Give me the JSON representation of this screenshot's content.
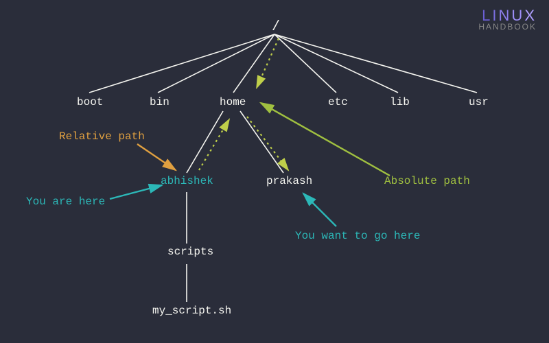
{
  "logo": {
    "top": "LINUX",
    "bottom": "HANDBOOK"
  },
  "tree": {
    "root": "/",
    "level1": {
      "boot": "boot",
      "bin": "bin",
      "home": "home",
      "etc": "etc",
      "lib": "lib",
      "usr": "usr"
    },
    "home_children": {
      "abhishek": "abhishek",
      "prakash": "prakash"
    },
    "abhishek_children": {
      "scripts": "scripts"
    },
    "scripts_children": {
      "my_script": "my_script.sh"
    }
  },
  "callouts": {
    "relative_path": "Relative path",
    "you_are_here": "You are here",
    "you_want_to_go_here": "You want to go here",
    "absolute_path": "Absolute path"
  }
}
